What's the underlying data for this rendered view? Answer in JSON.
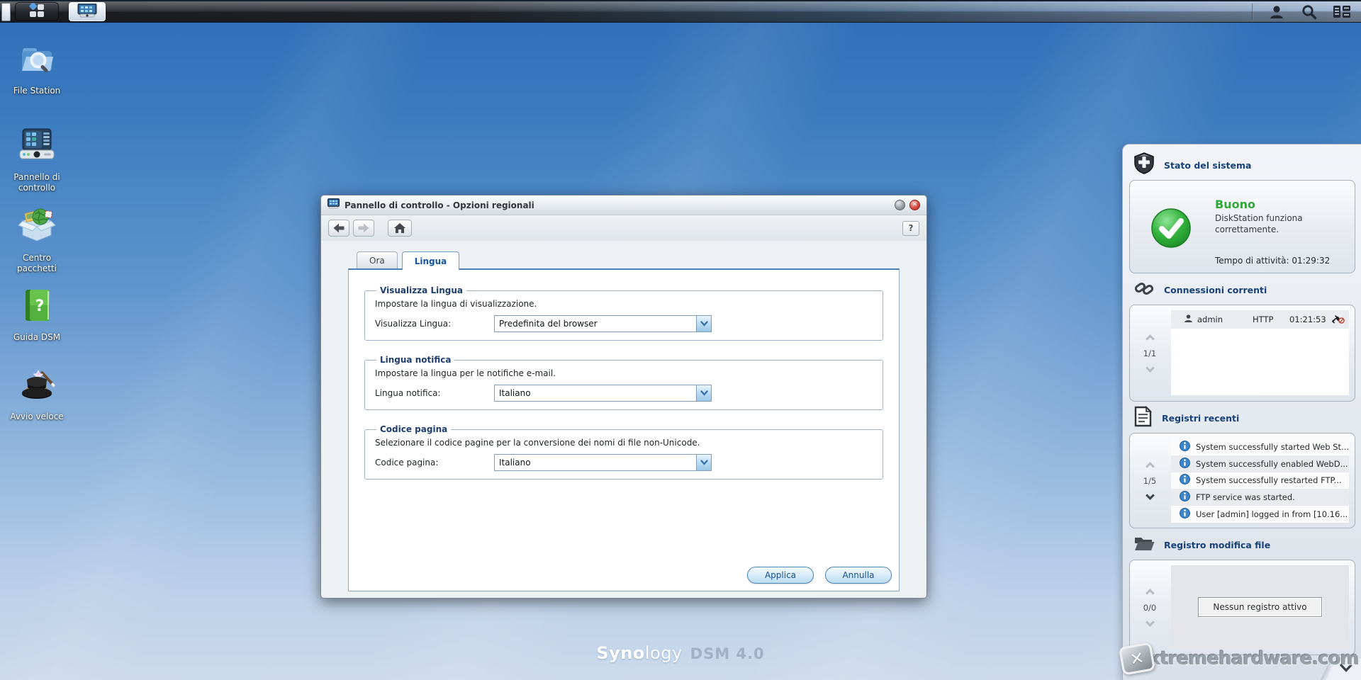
{
  "icons": {
    "close": "✕",
    "question_mark": "?",
    "info": "i"
  },
  "desktop": {
    "icons": [
      {
        "label": "File Station"
      },
      {
        "label": "Pannello di controllo"
      },
      {
        "label": "Centro pacchetti"
      },
      {
        "label": "Guida DSM"
      },
      {
        "label": "Avvio veloce"
      }
    ]
  },
  "dialog": {
    "title": "Pannello di controllo - Opzioni regionali",
    "help_label": "?",
    "tabs": [
      {
        "label": "Ora"
      },
      {
        "label": "Lingua"
      }
    ],
    "sections": [
      {
        "legend": "Visualizza Lingua",
        "description": "Impostare la lingua di visualizzazione.",
        "field_label": "Visualizza Lingua:",
        "value": "Predefinita del browser"
      },
      {
        "legend": "Lingua notifica",
        "description": "Impostare la lingua per le notifiche e-mail.",
        "field_label": "Lingua notifica:",
        "value": "Italiano"
      },
      {
        "legend": "Codice pagina",
        "description": "Selezionare il codice pagine per la conversione dei nomi di file non-Unicode.",
        "field_label": "Codice pagina:",
        "value": "Italiano"
      }
    ],
    "buttons": {
      "apply": "Applica",
      "cancel": "Annulla"
    }
  },
  "widgets": {
    "system_status": {
      "title": "Stato del sistema",
      "status": "Buono",
      "description": "DiskStation funziona correttamente.",
      "uptime": "Tempo di attività: 01:29:32"
    },
    "connections": {
      "title": "Connessioni correnti",
      "page": "1/1",
      "rows": [
        {
          "user": "admin",
          "protocol": "HTTP",
          "time": "01:21:53"
        }
      ]
    },
    "recent_logs": {
      "title": "Registri recenti",
      "page": "1/5",
      "rows": [
        {
          "text": "System successfully started Web St..."
        },
        {
          "text": "System successfully enabled WebD..."
        },
        {
          "text": "System successfully restarted FTP..."
        },
        {
          "text": "FTP service was started."
        },
        {
          "text": "User [admin] logged in from [10.16..."
        }
      ]
    },
    "file_log": {
      "title": "Registro modifica file",
      "page": "0/0",
      "empty_message": "Nessun registro attivo"
    }
  },
  "branding": {
    "logo_bold": "Syno",
    "logo_light": "logy",
    "logo_suffix": "DSM 4.0"
  },
  "watermark": {
    "badge": "✕",
    "text": "xtremehardware.com"
  },
  "colors": {
    "accent_blue": "#15549e",
    "header_navy": "#16417c",
    "status_green": "#2fa838",
    "desktop_top": "#2e6db6",
    "desktop_bottom": "#ccdaec"
  }
}
